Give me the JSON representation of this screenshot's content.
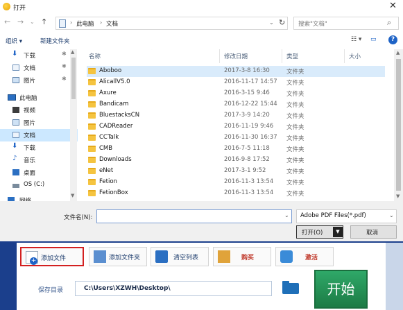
{
  "window": {
    "title": "打开",
    "close": "✕"
  },
  "address": {
    "segments": [
      "此电脑",
      "文档"
    ],
    "search_placeholder": "搜索\"文档\""
  },
  "commands": {
    "organize": "组织 ▾",
    "new_folder": "新建文件夹"
  },
  "nav": {
    "items": [
      {
        "label": "下载",
        "icon": "download-icon",
        "pinned": true
      },
      {
        "label": "文档",
        "icon": "document-icon",
        "pinned": true
      },
      {
        "label": "图片",
        "icon": "picture-icon",
        "pinned": true
      },
      {
        "label": "此电脑",
        "icon": "computer-icon",
        "pinned": false
      },
      {
        "label": "视频",
        "icon": "video-icon",
        "pinned": false
      },
      {
        "label": "图片",
        "icon": "picture-icon",
        "pinned": false
      },
      {
        "label": "文档",
        "icon": "document-icon",
        "pinned": false,
        "selected": true
      },
      {
        "label": "下载",
        "icon": "download-icon",
        "pinned": false
      },
      {
        "label": "音乐",
        "icon": "music-icon",
        "pinned": false
      },
      {
        "label": "桌面",
        "icon": "desktop-icon",
        "pinned": false
      },
      {
        "label": "OS (C:)",
        "icon": "drive-icon",
        "pinned": false
      },
      {
        "label": "网络",
        "icon": "network-icon",
        "pinned": false
      }
    ]
  },
  "columns": {
    "name": "名称",
    "date": "修改日期",
    "type": "类型",
    "size": "大小"
  },
  "files": [
    {
      "name": "Aboboo",
      "date": "2017-3-8 16:30",
      "type": "文件夹",
      "selected": true
    },
    {
      "name": "AlicallV5.0",
      "date": "2016-11-17 14:57",
      "type": "文件夹"
    },
    {
      "name": "Axure",
      "date": "2016-3-15 9:46",
      "type": "文件夹"
    },
    {
      "name": "Bandicam",
      "date": "2016-12-22 15:44",
      "type": "文件夹"
    },
    {
      "name": "BluestacksCN",
      "date": "2017-3-9 14:20",
      "type": "文件夹"
    },
    {
      "name": "CADReader",
      "date": "2016-11-19 9:46",
      "type": "文件夹"
    },
    {
      "name": "CCTalk",
      "date": "2016-11-30 16:37",
      "type": "文件夹"
    },
    {
      "name": "CMB",
      "date": "2016-7-5 11:18",
      "type": "文件夹"
    },
    {
      "name": "Downloads",
      "date": "2016-9-8 17:52",
      "type": "文件夹"
    },
    {
      "name": "eNet",
      "date": "2017-3-1 9:52",
      "type": "文件夹"
    },
    {
      "name": "Fetion",
      "date": "2016-11-3 13:54",
      "type": "文件夹"
    },
    {
      "name": "FetionBox",
      "date": "2016-11-3 13:54",
      "type": "文件夹"
    }
  ],
  "dialog_bottom": {
    "filename_label": "文件名(N):",
    "filename_value": "",
    "filetype": "Adobe PDF Files(*.pdf)",
    "open": "打开(O)",
    "cancel": "取消"
  },
  "app": {
    "add_file": "添加文件",
    "add_folder": "添加文件夹",
    "clear_list": "清空列表",
    "buy": "购买",
    "activate": "激活",
    "save_label": "保存目录",
    "save_path": "C:\\Users\\XZWH\\Desktop\\",
    "start": "开始"
  },
  "colors": {
    "accent": "#1e63c6",
    "app_header": "#1b3f8c",
    "start": "#1c7b45",
    "highlight": "#d32020"
  }
}
